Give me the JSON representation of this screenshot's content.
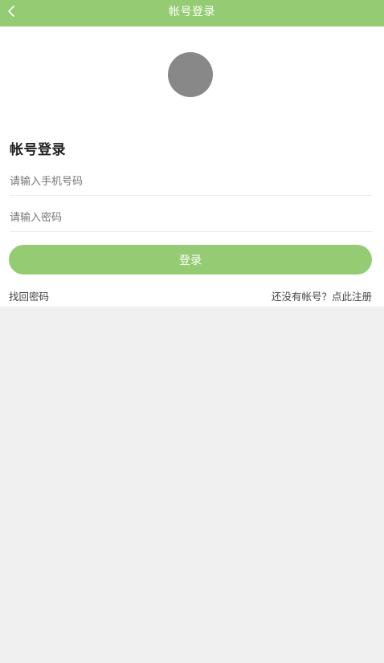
{
  "header": {
    "title": "帐号登录",
    "back_icon": "chevron-left-icon",
    "bg_color": "#95cc73"
  },
  "login": {
    "heading": "帐号登录",
    "phone_placeholder": "请输入手机号码",
    "password_placeholder": "请输入密码",
    "submit_label": "登录",
    "forgot_link": "找回密码",
    "register_link": "还没有帐号？点此注册"
  }
}
